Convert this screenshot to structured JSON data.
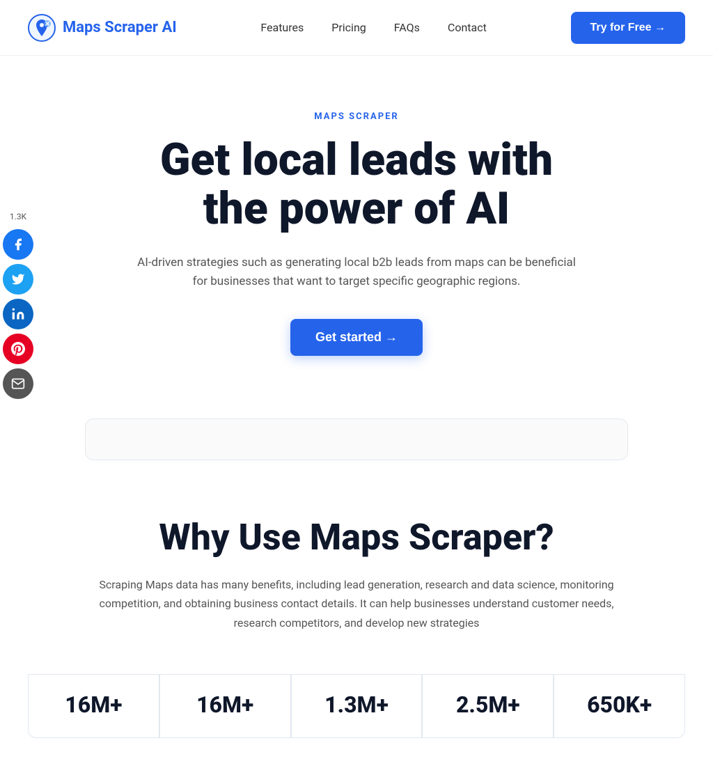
{
  "nav": {
    "logo_text": "Maps Scraper AI",
    "links": [
      {
        "label": "Features",
        "id": "features"
      },
      {
        "label": "Pricing",
        "id": "pricing"
      },
      {
        "label": "FAQs",
        "id": "faqs"
      },
      {
        "label": "Contact",
        "id": "contact"
      }
    ],
    "cta_label": "Try for Free →"
  },
  "social": {
    "count": "1.3K",
    "platforms": [
      {
        "name": "facebook",
        "icon": "f"
      },
      {
        "name": "twitter",
        "icon": "t"
      },
      {
        "name": "linkedin",
        "icon": "in"
      },
      {
        "name": "pinterest",
        "icon": "p"
      },
      {
        "name": "email",
        "icon": "@"
      }
    ]
  },
  "hero": {
    "tag": "MAPS SCRAPER",
    "title_line1": "Get local leads with",
    "title_line2": "the power of AI",
    "subtitle": "AI-driven strategies such as generating local b2b leads from maps can be beneficial for businesses that want to target specific geographic regions.",
    "cta_label": "Get started →"
  },
  "why": {
    "title": "Why Use Maps Scraper?",
    "description": "Scraping Maps data has many benefits, including lead generation, research and data science, monitoring competition, and obtaining business contact details. It can help businesses understand customer needs, research competitors, and develop new strategies"
  },
  "stats": [
    {
      "value": "16M+",
      "label": ""
    },
    {
      "value": "16M+",
      "label": ""
    },
    {
      "value": "1.3M+",
      "label": ""
    },
    {
      "value": "2.5M+",
      "label": ""
    },
    {
      "value": "650K+",
      "label": ""
    }
  ]
}
